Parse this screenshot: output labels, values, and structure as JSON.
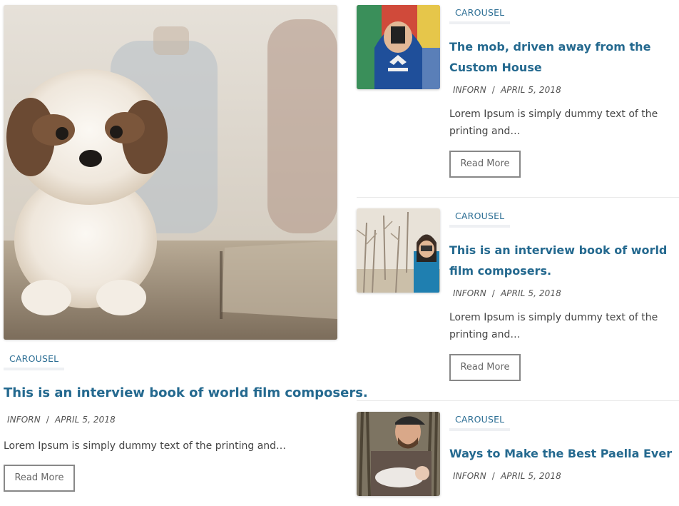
{
  "featured": {
    "image_alt": "puppy-photo",
    "category": "CAROUSEL",
    "title": "This is an interview book of world film composers.",
    "author": "INFORN",
    "separator": "/",
    "date": "APRIL 5, 2018",
    "excerpt": "Lorem Ipsum is simply dummy text of the printing and…",
    "button": "Read More"
  },
  "posts": [
    {
      "category": "CAROUSEL",
      "title": "The mob, driven away from the Custom House",
      "author": "INFORN",
      "separator": "/",
      "date": "APRIL 5, 2018",
      "excerpt": "Lorem Ipsum is simply dummy text of the printing and…",
      "button": "Read More"
    },
    {
      "category": "CAROUSEL",
      "title": "This is an interview book of world film composers.",
      "author": "INFORN",
      "separator": "/",
      "date": "APRIL 5, 2018",
      "excerpt": "Lorem Ipsum is simply dummy text of the printing and…",
      "button": "Read More"
    },
    {
      "category": "CAROUSEL",
      "title": "Ways to Make the Best Paella Ever",
      "author": "INFORN",
      "separator": "/",
      "date": "APRIL 5, 2018"
    }
  ],
  "colors": {
    "title": "#24698f",
    "category": "#2c6e94",
    "button_border": "#888888"
  }
}
